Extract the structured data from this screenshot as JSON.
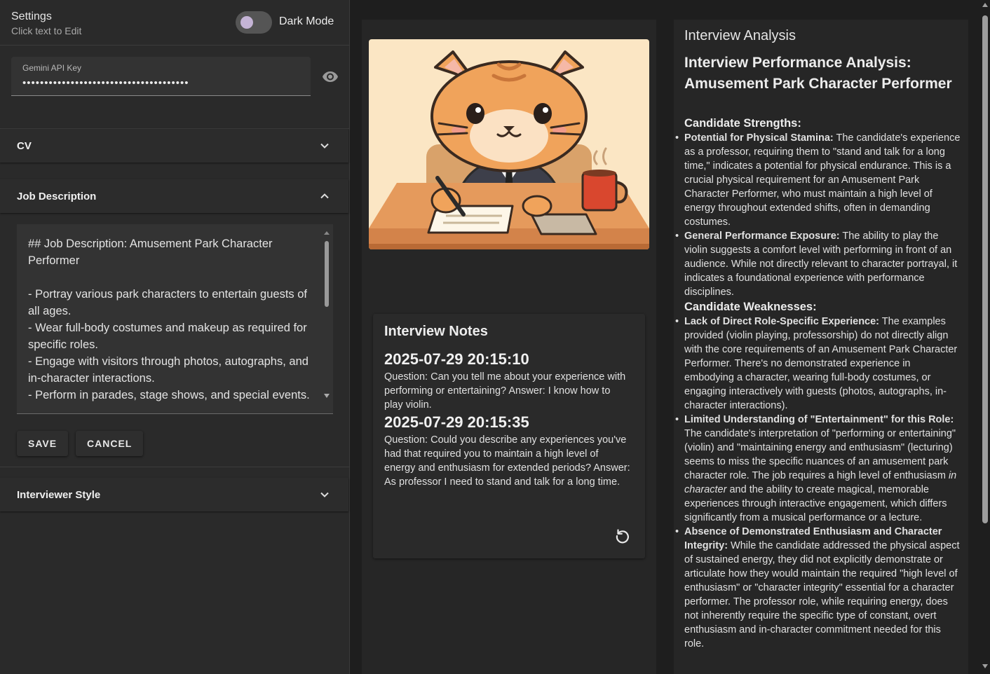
{
  "settings": {
    "title": "Settings",
    "subtitle": "Click text to Edit",
    "dark_mode_label": "Dark Mode",
    "dark_mode_on": false,
    "api_key_label": "Gemini API Key",
    "api_key_value": "••••••••••••••••••••••••••••••••••••••"
  },
  "accordions": {
    "cv": "CV",
    "job_description": "Job Description",
    "interviewer_style": "Interviewer Style"
  },
  "job_description_text": "## Job Description: Amusement Park Character Performer\n\n- Portray various park characters to entertain guests of all ages.\n- Wear full-body costumes and makeup as required for specific roles.\n- Engage with visitors through photos, autographs, and in-character interactions.\n- Perform in parades, stage shows, and special events.",
  "buttons": {
    "save": "SAVE",
    "cancel": "CANCEL"
  },
  "notes": {
    "title": "Interview Notes",
    "entries": [
      {
        "timestamp": "2025-07-29 20:15:10",
        "text": "Question: Can you tell me about your experience with performing or entertaining? Answer: I know how to play violin."
      },
      {
        "timestamp": "2025-07-29 20:15:35",
        "text": "Question: Could you describe any experiences you've had that required you to maintain a high level of energy and enthusiasm for extended periods? Answer: As professor I need to stand and talk for a long time."
      }
    ]
  },
  "analysis": {
    "panel_title": "Interview Analysis",
    "heading": "Interview Performance Analysis: Amusement Park Character Performer",
    "strengths_heading": "Candidate Strengths:",
    "strengths": [
      {
        "bold": "Potential for Physical Stamina:",
        "text": " The candidate's experience as a professor, requiring them to \"stand and talk for a long time,\" indicates a potential for physical endurance. This is a crucial physical requirement for an Amusement Park Character Performer, who must maintain a high level of energy throughout extended shifts, often in demanding costumes."
      },
      {
        "bold": "General Performance Exposure:",
        "text": " The ability to play the violin suggests a comfort level with performing in front of an audience. While not directly relevant to character portrayal, it indicates a foundational experience with performance disciplines."
      }
    ],
    "weaknesses_heading": "Candidate Weaknesses:",
    "weaknesses": [
      {
        "bold": "Lack of Direct Role-Specific Experience:",
        "text": " The examples provided (violin playing, professorship) do not directly align with the core requirements of an Amusement Park Character Performer. There's no demonstrated experience in embodying a character, wearing full-body costumes, or engaging interactively with guests (photos, autographs, in-character interactions)."
      },
      {
        "bold": "Limited Understanding of \"Entertainment\" for this Role:",
        "text_before": " The candidate's interpretation of \"performing or entertaining\" (violin) and \"maintaining energy and enthusiasm\" (lecturing) seems to miss the specific nuances of an amusement park character role. The job requires a high level of enthusiasm ",
        "italic": "in character",
        "text_after": " and the ability to create magical, memorable experiences through interactive engagement, which differs significantly from a musical performance or a lecture."
      },
      {
        "bold": "Absence of Demonstrated Enthusiasm and Character Integrity:",
        "text": " While the candidate addressed the physical aspect of sustained energy, they did not explicitly demonstrate or articulate how they would maintain the required \"high level of enthusiasm\" or \"character integrity\" essential for a character performer. The professor role, while requiring energy, does not inherently require the specific type of constant, overt enthusiasm and in-character commitment needed for this role."
      }
    ]
  },
  "colors": {
    "page_bg": "#1e1e1e",
    "panel_bg": "#2a2a2a",
    "column_bg": "#262626",
    "toggle_knob": "#c5b4d6"
  },
  "icons": {
    "visibility": "eye-icon",
    "chevron_down": "chevron-down-icon",
    "chevron_up": "chevron-up-icon",
    "refresh": "refresh-icon",
    "hero_image": "cat-interviewer-illustration"
  }
}
